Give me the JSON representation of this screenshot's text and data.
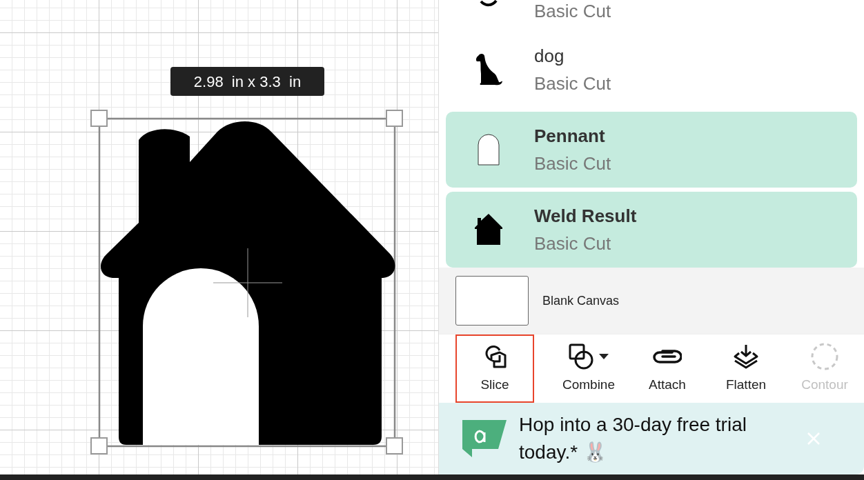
{
  "canvas": {
    "size_tooltip": "2.98  in x 3.3  in"
  },
  "layers": [
    {
      "kind": "partial",
      "operation": "Basic Cut",
      "selected": false
    },
    {
      "kind": "dog",
      "name": "dog",
      "operation": "Basic Cut",
      "selected": false
    },
    {
      "kind": "pennant",
      "name": "Pennant",
      "operation": "Basic Cut",
      "selected": true
    },
    {
      "kind": "house",
      "name": "Weld Result",
      "operation": "Basic Cut",
      "selected": true
    }
  ],
  "blank_canvas": {
    "label": "Blank Canvas"
  },
  "tools": [
    {
      "kind": "slice",
      "label": "Slice",
      "selected": true,
      "disabled": false,
      "dropdown": false
    },
    {
      "kind": "combine",
      "label": "Combine",
      "selected": false,
      "disabled": false,
      "dropdown": true
    },
    {
      "kind": "attach",
      "label": "Attach",
      "selected": false,
      "disabled": false,
      "dropdown": false
    },
    {
      "kind": "flatten",
      "label": "Flatten",
      "selected": false,
      "disabled": false,
      "dropdown": false
    },
    {
      "kind": "contour",
      "label": "Contour",
      "selected": false,
      "disabled": true,
      "dropdown": false
    }
  ],
  "banner": {
    "text": "Hop into a 30-day free trial today.* 🐰"
  }
}
